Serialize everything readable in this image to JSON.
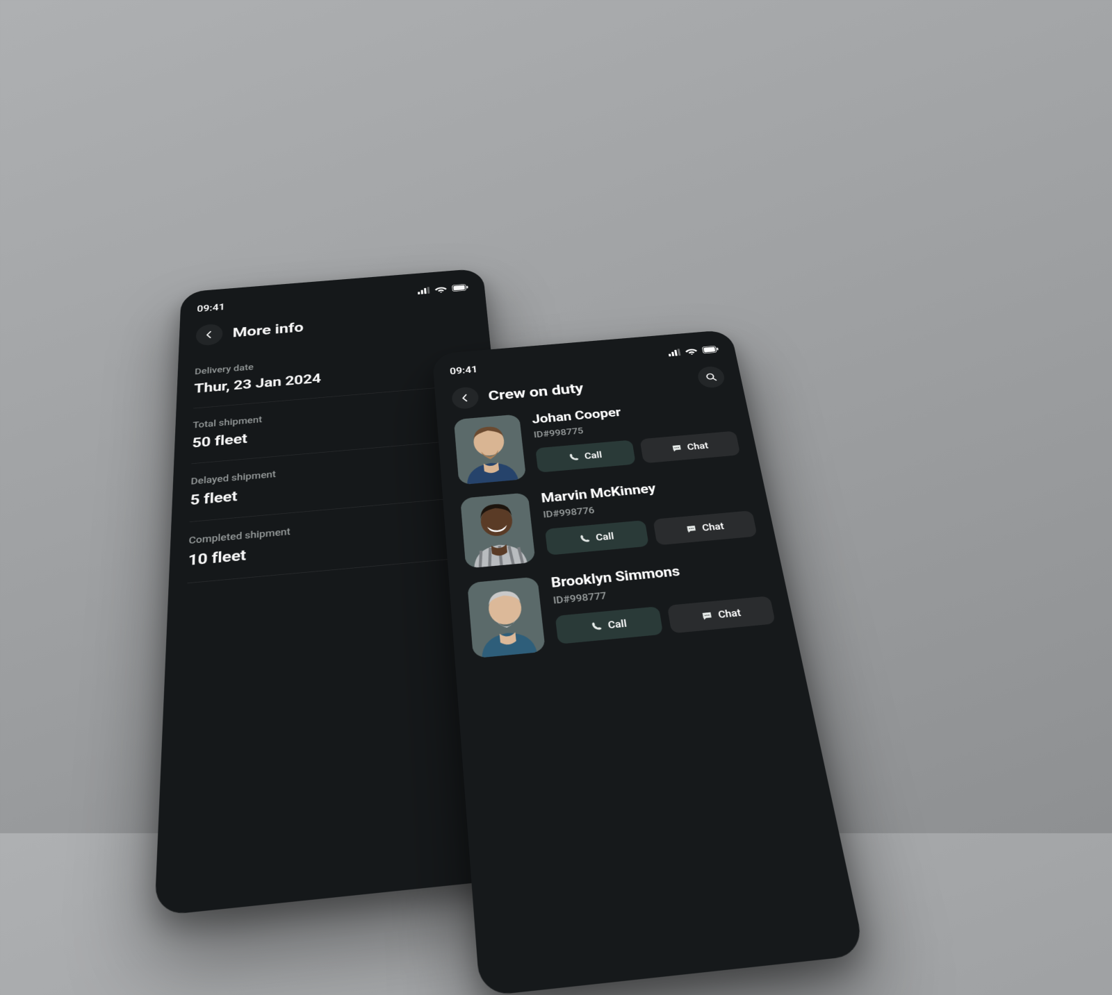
{
  "statusbar": {
    "time": "09:41"
  },
  "screen_left": {
    "title": "More info",
    "rows": [
      {
        "label": "Delivery date",
        "value": "Thur, 23 Jan 2024"
      },
      {
        "label": "Total shipment",
        "value": "50 fleet"
      },
      {
        "label": "Delayed shipment",
        "value": "5 fleet"
      },
      {
        "label": "Completed shipment",
        "value": "10 fleet"
      }
    ]
  },
  "screen_right": {
    "title": "Crew on duty",
    "call_label": "Call",
    "chat_label": "Chat",
    "crew": [
      {
        "name": "Johan Cooper",
        "id": "ID#998775"
      },
      {
        "name": "Marvin McKinney",
        "id": "ID#998776"
      },
      {
        "name": "Brooklyn Simmons",
        "id": "ID#998777"
      }
    ]
  }
}
